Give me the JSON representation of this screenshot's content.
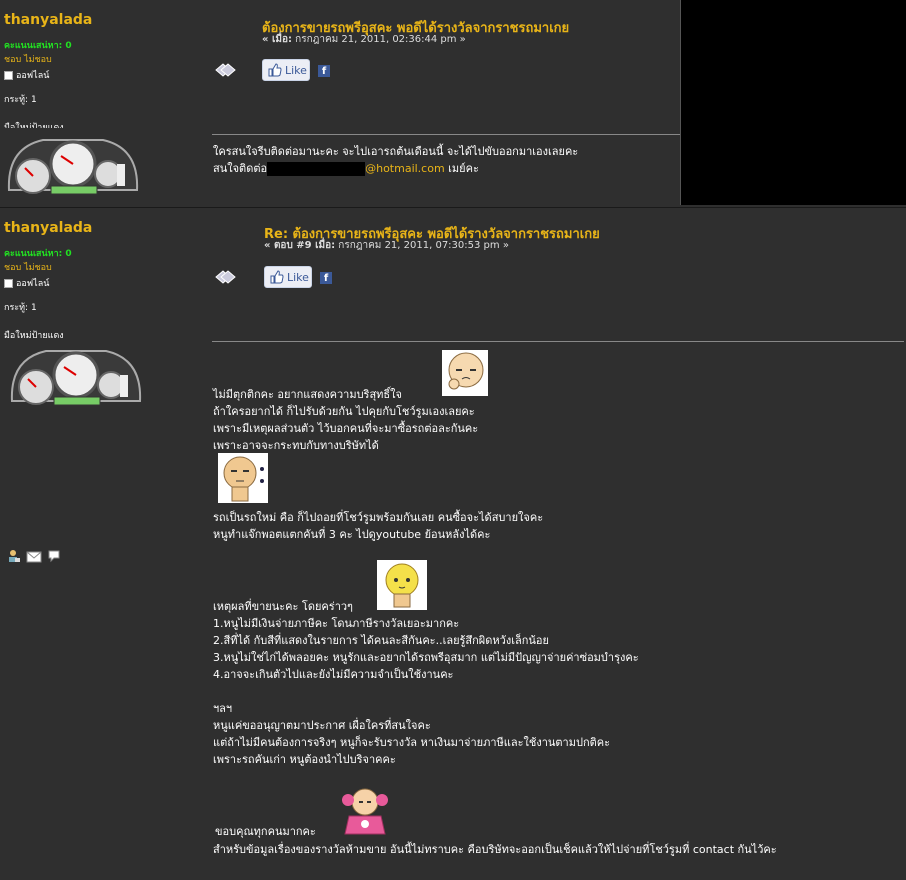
{
  "post1": {
    "author": "thanyalada",
    "karma_label": "คะแนนเสน่หา: 0",
    "karma_actions": "ชอบ ไม่ชอบ",
    "status": "ออฟไลน์",
    "posts": "กระทู้: 1",
    "rank": "มือใหม่ป้ายแดง",
    "subject": "ต้องการขายรถพรีอุสคะ พอดีได้รางวัลจากราชรถมาเกย",
    "meta_prefix": "« เมื่อ:",
    "meta_date": "กรกฎาคม 21, 2011, 02:36:44 pm »",
    "like_label": "Like",
    "body_line1": "ใครสนใจรีบติดต่อมานะคะ จะไปเอารถต้นเดือนนี้ จะได้ไปขับออกมาเองเลยคะ",
    "body_line2_prefix": "สนใจติดต่อ",
    "email_suffix": "@hotmail.com",
    "body_line2_suffix": " เมย์คะ"
  },
  "post2": {
    "author": "thanyalada",
    "karma_label": "คะแนนเสน่หา: 0",
    "karma_actions": "ชอบ ไม่ชอบ",
    "status": "ออฟไลน์",
    "posts": "กระทู้: 1",
    "rank": "มือใหม่ป้ายแดง",
    "subject": "Re: ต้องการขายรถพรีอุสคะ พอดีได้รางวัลจากราชรถมาเกย",
    "meta_prefix": "« ตอบ #9 เมื่อ:",
    "meta_date": "กรกฎาคม 21, 2011, 07:30:53 pm »",
    "like_label": "Like",
    "lines_a": [
      "ไม่มีตุกติกคะ อยากแสดงความบริสุทธิ์ใจ",
      "ถ้าใครอยากได้ ก็ไปรับด้วยกัน ไปคุยกับโชว์รูมเองเลยคะ",
      "เพราะมีเหตุผลส่วนตัว ไว้บอกคนที่จะมาซื้อรถต่อละกันคะ",
      "เพราะอาจจะกระทบกับทางบริษัทได้"
    ],
    "lines_b": [
      "รถเป็นรถใหม่ คือ ก็ไปถอยที่โชว์รูมพร้อมกันเลย คนซื้อจะได้สบายใจคะ",
      "หนูทำแจ๊กพอตแตกคันที่ 3 คะ ไปดูyoutube ย้อนหลังได้คะ"
    ],
    "lines_c": [
      "เหตุผลที่ขายนะคะ โดยคร่าวๆ",
      "1.หนูไม่มีเงินจ่ายภาษีคะ โดนภาษีรางวัลเยอะมากคะ",
      "2.สีที่ได้ กับสีที่แสดงในรายการ ได้คนละสีกันคะ..เลยรู้สึกผิดหวังเล็กน้อย",
      "3.หนูไม่ใช่ไก่ได้พลอยคะ หนูรักและอยากได้รถพรีอุสมาก แต่ไม่มีปัญญาจ่ายค่าซ่อมบำรุงคะ",
      "4.อาจจะเกินตัวไปและยังไม่มีความจำเป็นใช้งานคะ"
    ],
    "lines_d": [
      "ฯลฯ",
      "หนูแค่ขออนุญาตมาประกาศ เผื่อใครที่สนใจคะ",
      "แต่ถ้าไม่มีคนต้องการจริงๆ หนูก็จะรับรางวัล หาเงินมาจ่ายภาษีและใช้งานตามปกติคะ",
      "เพราะรถคันเก่า หนูต้องนำไปบริจาคคะ"
    ],
    "line_thanks": " ขอบคุณทุกคนมากคะ",
    "line_final": "สำหรับข้อมูลเรื่องของรางวัลห้ามขาย อันนี้ไม่ทราบคะ คือบริษัทจะออกเป็นเช็คแล้วให้ไปจ่ายที่โชว์รูมที่ contact กันไว้คะ"
  },
  "colors": {
    "background": "#2f2f2f",
    "accent": "#e8b418",
    "karma": "#22e022"
  }
}
